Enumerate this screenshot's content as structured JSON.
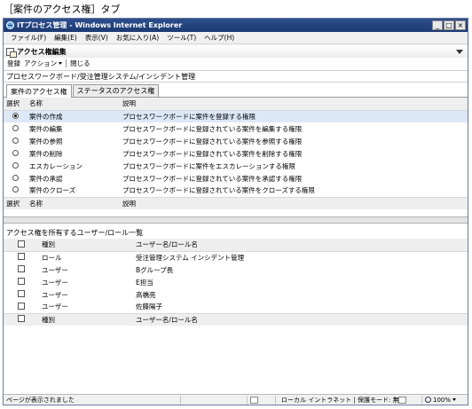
{
  "caption": "［案件のアクセス権］タブ",
  "window": {
    "title": "ITプロセス管理 - Windows Internet Explorer",
    "minimize": "_",
    "maximize": "□",
    "close": "×"
  },
  "menu": [
    "ファイル(F)",
    "編集(E)",
    "表示(V)",
    "お気に入り(A)",
    "ツール(T)",
    "ヘルプ(H)"
  ],
  "portlet": {
    "title": "アクセス権編集"
  },
  "toolbar": {
    "register": "登録",
    "action": "アクション",
    "close": "閉じる"
  },
  "breadcrumb": "プロセスワークボード/受注管理システム/インシデント管理",
  "tabs": [
    {
      "label": "案件のアクセス権",
      "active": true
    },
    {
      "label": "ステータスのアクセス権",
      "active": false
    }
  ],
  "permissions": {
    "headers": {
      "select": "選択",
      "name": "名称",
      "description": "説明"
    },
    "rows": [
      {
        "selected": true,
        "name": "案件の作成",
        "description": "プロセスワークボードに案件を登録する権限"
      },
      {
        "selected": false,
        "name": "案件の編集",
        "description": "プロセスワークボードに登録されている案件を編集する権限"
      },
      {
        "selected": false,
        "name": "案件の参照",
        "description": "プロセスワークボードに登録されている案件を参照する権限"
      },
      {
        "selected": false,
        "name": "案件の削除",
        "description": "プロセスワークボードに登録されている案件を削除する権限"
      },
      {
        "selected": false,
        "name": "エスカレーション",
        "description": "プロセスワークボードに案件をエスカレーションする権限"
      },
      {
        "selected": false,
        "name": "案件の承認",
        "description": "プロセスワークボードに登録されている案件を承認する権限"
      },
      {
        "selected": false,
        "name": "案件のクローズ",
        "description": "プロセスワークボードに登録されている案件をクローズする権限"
      }
    ]
  },
  "users": {
    "section_title": "アクセス権を所有するユーザー/ロール一覧",
    "headers": {
      "type": "種別",
      "name": "ユーザー名/ロール名"
    },
    "rows": [
      {
        "type": "ロール",
        "name": "受注管理システム インシデント管理"
      },
      {
        "type": "ユーザー",
        "name": "Bグループ長"
      },
      {
        "type": "ユーザー",
        "name": "E担当"
      },
      {
        "type": "ユーザー",
        "name": "高橋亮"
      },
      {
        "type": "ユーザー",
        "name": "佐藤陽子"
      }
    ]
  },
  "statusbar": {
    "message": "ページが表示されました",
    "zone": "ローカル イントラネット | 保護モード: 無効",
    "zoom": "100%"
  }
}
